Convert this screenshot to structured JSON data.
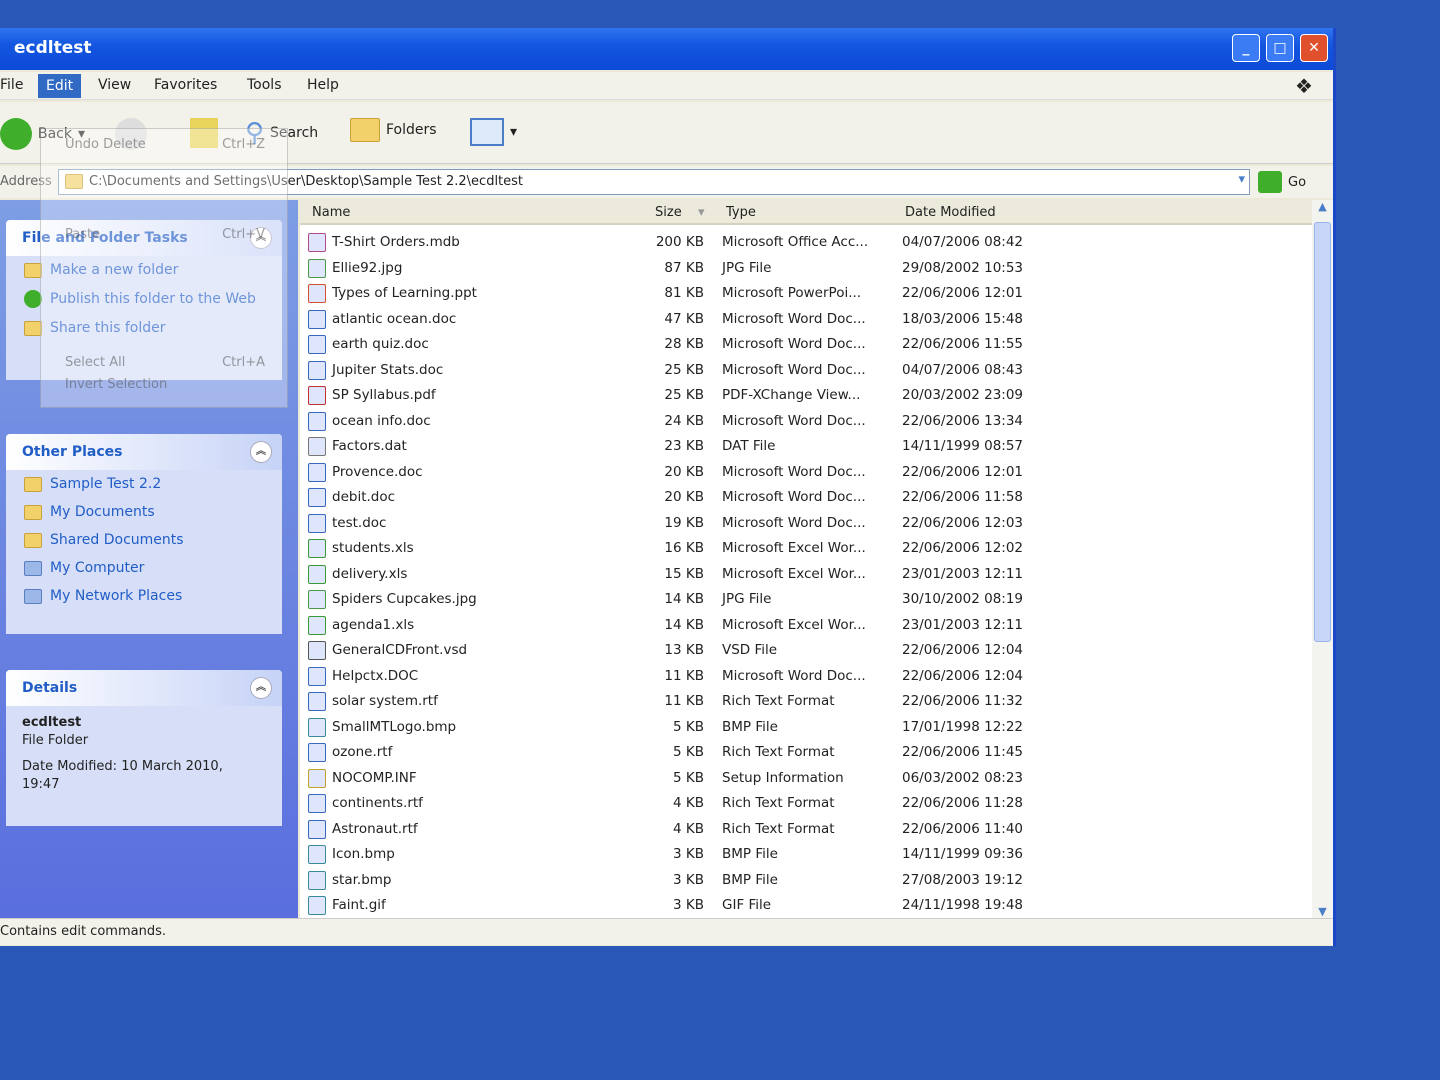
{
  "window": {
    "title": "ecdltest",
    "min": "_",
    "max": "□",
    "close": "✕"
  },
  "menu": [
    "File",
    "Edit",
    "View",
    "Favorites",
    "Tools",
    "Help"
  ],
  "toolbar": {
    "back": "Back",
    "search": "Search",
    "folders": "Folders"
  },
  "address": {
    "label": "Address",
    "path": "C:\\Documents and Settings\\User\\Desktop\\Sample Test 2.2\\ecdltest",
    "go": "Go"
  },
  "edit_menu": [
    {
      "label": "Undo Delete",
      "shortcut": "Ctrl+Z"
    },
    {
      "label": "Paste",
      "shortcut": "Ctrl+V"
    },
    {
      "label": "Select All",
      "shortcut": "Ctrl+A"
    },
    {
      "label": "Invert Selection",
      "shortcut": ""
    }
  ],
  "tasks": {
    "title": "File and Folder Tasks",
    "items": [
      "Make a new folder",
      "Publish this folder to the Web",
      "Share this folder"
    ]
  },
  "other_places": {
    "title": "Other Places",
    "items": [
      "Sample Test 2.2",
      "My Documents",
      "Shared Documents",
      "My Computer",
      "My Network Places"
    ]
  },
  "details": {
    "title": "Details",
    "name": "ecdltest",
    "kind": "File Folder",
    "modified": "Date Modified: 10 March 2010, 19:47"
  },
  "columns": [
    "Name",
    "Size",
    "Type",
    "Date Modified"
  ],
  "files": [
    [
      "T-Shirt Orders.mdb",
      "200 KB",
      "Microsoft Office Acc...",
      "04/07/2006 08:42"
    ],
    [
      "Ellie92.jpg",
      "87 KB",
      "JPG File",
      "29/08/2002 10:53"
    ],
    [
      "Types of Learning.ppt",
      "81 KB",
      "Microsoft PowerPoi...",
      "22/06/2006 12:01"
    ],
    [
      "atlantic ocean.doc",
      "47 KB",
      "Microsoft Word Doc...",
      "18/03/2006 15:48"
    ],
    [
      "earth quiz.doc",
      "28 KB",
      "Microsoft Word Doc...",
      "22/06/2006 11:55"
    ],
    [
      "Jupiter Stats.doc",
      "25 KB",
      "Microsoft Word Doc...",
      "04/07/2006 08:43"
    ],
    [
      "SP Syllabus.pdf",
      "25 KB",
      "PDF-XChange View...",
      "20/03/2002 23:09"
    ],
    [
      "ocean info.doc",
      "24 KB",
      "Microsoft Word Doc...",
      "22/06/2006 13:34"
    ],
    [
      "Factors.dat",
      "23 KB",
      "DAT File",
      "14/11/1999 08:57"
    ],
    [
      "Provence.doc",
      "20 KB",
      "Microsoft Word Doc...",
      "22/06/2006 12:01"
    ],
    [
      "debit.doc",
      "20 KB",
      "Microsoft Word Doc...",
      "22/06/2006 11:58"
    ],
    [
      "test.doc",
      "19 KB",
      "Microsoft Word Doc...",
      "22/06/2006 12:03"
    ],
    [
      "students.xls",
      "16 KB",
      "Microsoft Excel Wor...",
      "22/06/2006 12:02"
    ],
    [
      "delivery.xls",
      "15 KB",
      "Microsoft Excel Wor...",
      "23/01/2003 12:11"
    ],
    [
      "Spiders Cupcakes.jpg",
      "14 KB",
      "JPG File",
      "30/10/2002 08:19"
    ],
    [
      "agenda1.xls",
      "14 KB",
      "Microsoft Excel Wor...",
      "23/01/2003 12:11"
    ],
    [
      "GeneralCDFront.vsd",
      "13 KB",
      "VSD File",
      "22/06/2006 12:04"
    ],
    [
      "Helpctx.DOC",
      "11 KB",
      "Microsoft Word Doc...",
      "22/06/2006 12:04"
    ],
    [
      "solar system.rtf",
      "11 KB",
      "Rich Text Format",
      "22/06/2006 11:32"
    ],
    [
      "SmallMTLogo.bmp",
      "5 KB",
      "BMP File",
      "17/01/1998 12:22"
    ],
    [
      "ozone.rtf",
      "5 KB",
      "Rich Text Format",
      "22/06/2006 11:45"
    ],
    [
      "NOCOMP.INF",
      "5 KB",
      "Setup Information",
      "06/03/2002 08:23"
    ],
    [
      "continents.rtf",
      "4 KB",
      "Rich Text Format",
      "22/06/2006 11:28"
    ],
    [
      "Astronaut.rtf",
      "4 KB",
      "Rich Text Format",
      "22/06/2006 11:40"
    ],
    [
      "Icon.bmp",
      "3 KB",
      "BMP File",
      "14/11/1999 09:36"
    ],
    [
      "star.bmp",
      "3 KB",
      "BMP File",
      "27/08/2003 19:12"
    ],
    [
      "Faint.gif",
      "3 KB",
      "GIF File",
      "24/11/1998 19:48"
    ]
  ],
  "status": "Contains edit commands."
}
